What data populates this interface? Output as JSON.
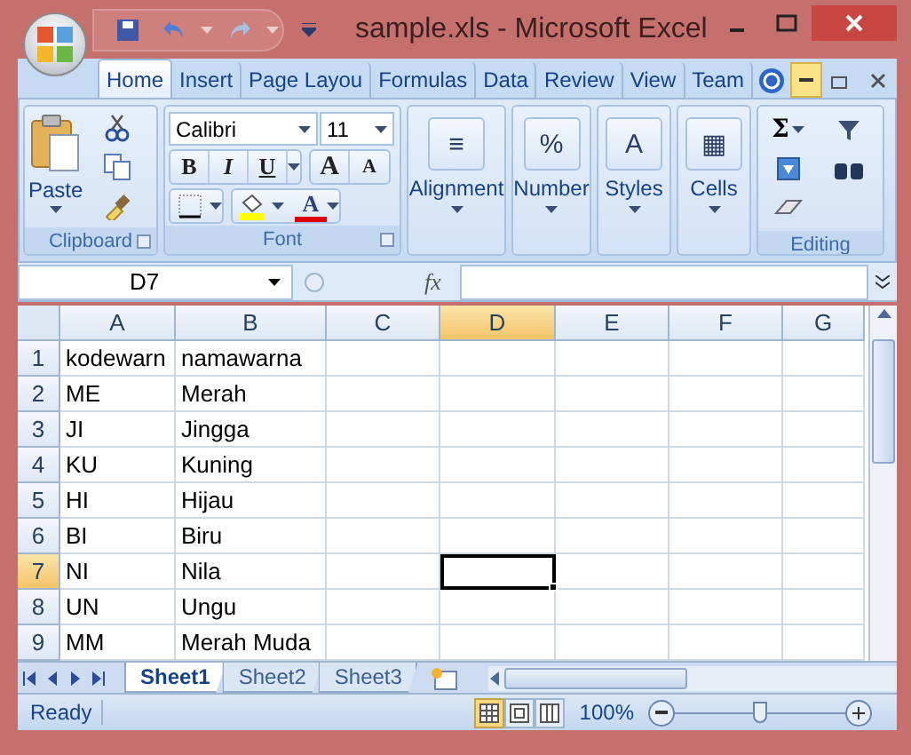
{
  "window": {
    "title": "sample.xls - Microsoft Excel"
  },
  "tabs": [
    {
      "label": "Home",
      "selected": true
    },
    {
      "label": "Insert",
      "selected": false
    },
    {
      "label": "Page Layou",
      "selected": false
    },
    {
      "label": "Formulas",
      "selected": false
    },
    {
      "label": "Data",
      "selected": false
    },
    {
      "label": "Review",
      "selected": false
    },
    {
      "label": "View",
      "selected": false
    },
    {
      "label": "Team",
      "selected": false
    }
  ],
  "ribbon": [
    {
      "kind": "clipboard",
      "title": "Clipboard",
      "button": "Paste"
    },
    {
      "kind": "font",
      "title": "Font",
      "font": "Calibri",
      "size": "11",
      "style_buttons": [
        "B",
        "I",
        "U"
      ],
      "grow": "A",
      "shrink": "A",
      "color_letter": "A"
    },
    {
      "kind": "collapsed",
      "label": "Alignment",
      "glyph": "≡"
    },
    {
      "kind": "collapsed",
      "label": "Number",
      "glyph": "%"
    },
    {
      "kind": "collapsed",
      "label": "Styles",
      "glyph": "A"
    },
    {
      "kind": "collapsed",
      "label": "Cells",
      "glyph": "▦"
    },
    {
      "kind": "editing",
      "title": "Editing",
      "sum": "Σ"
    }
  ],
  "formula_bar": {
    "name_box": "D7",
    "fx": "fx"
  },
  "columns": [
    {
      "label": "A",
      "selected": false
    },
    {
      "label": "B",
      "selected": false
    },
    {
      "label": "C",
      "selected": false
    },
    {
      "label": "D",
      "selected": true
    },
    {
      "label": "E",
      "selected": false
    },
    {
      "label": "F",
      "selected": false
    },
    {
      "label": "G",
      "selected": false
    }
  ],
  "rows": [
    {
      "header": "1",
      "selected": false,
      "cells": [
        "kodewarn",
        "namawarna"
      ]
    },
    {
      "header": "2",
      "selected": false,
      "cells": [
        "ME",
        "Merah"
      ]
    },
    {
      "header": "3",
      "selected": false,
      "cells": [
        "JI",
        "Jingga"
      ]
    },
    {
      "header": "4",
      "selected": false,
      "cells": [
        "KU",
        "Kuning"
      ]
    },
    {
      "header": "5",
      "selected": false,
      "cells": [
        "HI",
        "Hijau"
      ]
    },
    {
      "header": "6",
      "selected": false,
      "cells": [
        "BI",
        "Biru"
      ]
    },
    {
      "header": "7",
      "selected": true,
      "cells": [
        "NI",
        "Nila"
      ]
    },
    {
      "header": "8",
      "selected": false,
      "cells": [
        "UN",
        "Ungu"
      ]
    },
    {
      "header": "9",
      "selected": false,
      "cells": [
        "MM",
        "Merah Muda"
      ]
    }
  ],
  "sheets": [
    {
      "label": "Sheet1",
      "selected": true
    },
    {
      "label": "Sheet2",
      "selected": false
    },
    {
      "label": "Sheet3",
      "selected": false
    }
  ],
  "status_bar": {
    "status": "Ready",
    "views": [
      {
        "selected": true
      },
      {
        "selected": false
      },
      {
        "selected": false
      }
    ],
    "zoom": "100%",
    "zoom_slider": {
      "level": 0.5
    }
  }
}
